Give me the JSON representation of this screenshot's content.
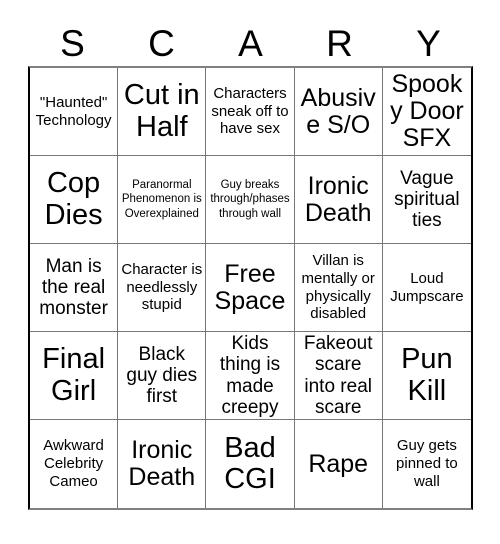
{
  "card": {
    "header_letters": [
      "S",
      "C",
      "A",
      "R",
      "Y"
    ],
    "colors": {
      "background": "#ffffff",
      "text": "#000000",
      "grid_line": "#777777",
      "outer_border_dark": "#000000",
      "outer_border_light": "#808080"
    },
    "rows": [
      [
        {
          "text": "\"Haunted\" Technology",
          "size": "sm"
        },
        {
          "text": "Cut in Half",
          "size": "xl"
        },
        {
          "text": "Characters sneak off to have sex",
          "size": "sm"
        },
        {
          "text": "Abusive S/O",
          "size": "lg"
        },
        {
          "text": "Spooky Door SFX",
          "size": "lg"
        }
      ],
      [
        {
          "text": "Cop Dies",
          "size": "xl"
        },
        {
          "text": "Paranormal Phenomenon is Overexplained",
          "size": "xs"
        },
        {
          "text": "Guy breaks through/phases through wall",
          "size": "xs"
        },
        {
          "text": "Ironic Death",
          "size": "lg"
        },
        {
          "text": "Vague spiritual ties",
          "size": "md"
        }
      ],
      [
        {
          "text": "Man is the real monster",
          "size": "md"
        },
        {
          "text": "Character is needlessly stupid",
          "size": "sm"
        },
        {
          "text": "Free Space",
          "size": "lg"
        },
        {
          "text": "Villan is mentally or physically disabled",
          "size": "sm"
        },
        {
          "text": "Loud Jumpscare",
          "size": "sm"
        }
      ],
      [
        {
          "text": "Final Girl",
          "size": "xl"
        },
        {
          "text": "Black guy dies first",
          "size": "md"
        },
        {
          "text": "Kids thing is made creepy",
          "size": "md"
        },
        {
          "text": "Fakeout scare into real scare",
          "size": "md"
        },
        {
          "text": "Pun Kill",
          "size": "xl"
        }
      ],
      [
        {
          "text": "Awkward Celebrity Cameo",
          "size": "sm"
        },
        {
          "text": "Ironic Death",
          "size": "lg"
        },
        {
          "text": "Bad CGI",
          "size": "xl"
        },
        {
          "text": "Rape",
          "size": "lg"
        },
        {
          "text": "Guy gets pinned to wall",
          "size": "sm"
        }
      ]
    ]
  }
}
